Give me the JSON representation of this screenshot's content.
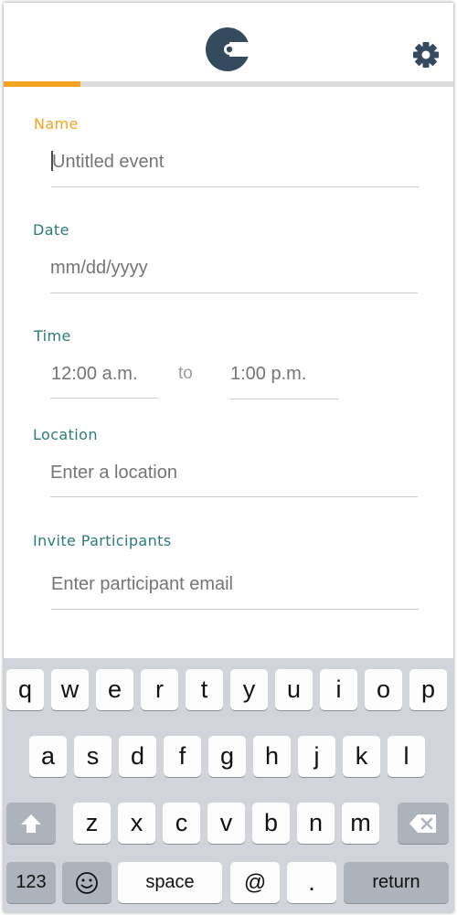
{
  "header": {
    "logo": "calendar-c-logo",
    "settings_icon": "gear-icon",
    "progress_percent": 17
  },
  "form": {
    "name": {
      "label": "Name",
      "placeholder": "Untitled event"
    },
    "date": {
      "label": "Date",
      "placeholder": "mm/dd/yyyy"
    },
    "time": {
      "label": "Time",
      "start_placeholder": "12:00 a.m.",
      "separator": "to",
      "end_placeholder": "1:00 p.m."
    },
    "location": {
      "label": "Location",
      "placeholder": "Enter a location"
    },
    "participants": {
      "label": "Invite Participants",
      "placeholder": "Enter participant email"
    }
  },
  "keyboard": {
    "row1": [
      "q",
      "w",
      "e",
      "r",
      "t",
      "y",
      "u",
      "i",
      "o",
      "p"
    ],
    "row2": [
      "a",
      "s",
      "d",
      "f",
      "g",
      "h",
      "j",
      "k",
      "l"
    ],
    "row3": [
      "z",
      "x",
      "c",
      "v",
      "b",
      "n",
      "m"
    ],
    "shift_icon": "shift-arrow-icon",
    "backspace_icon": "backspace-icon",
    "numbers_label": "123",
    "emoji_icon": "emoji-icon",
    "space_label": "space",
    "at_label": "@",
    "period_label": ".",
    "return_label": "return"
  },
  "colors": {
    "accent": "#f5a322",
    "label_teal": "#2e7a7a",
    "logo_navy": "#344b5f",
    "keyboard_bg": "#d1d5db"
  }
}
